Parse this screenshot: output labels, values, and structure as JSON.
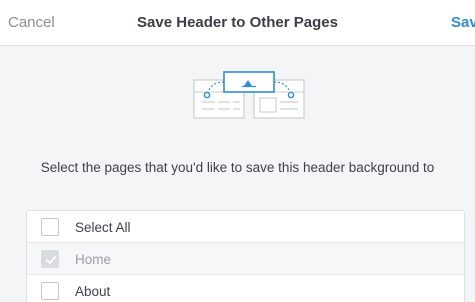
{
  "header": {
    "cancel_label": "Cancel",
    "title": "Save Header to Other Pages",
    "save_label": "Save"
  },
  "instruction": "Select the pages that you'd like to save this header background to",
  "pages": [
    {
      "label": "Select All",
      "checked": false,
      "disabled": false
    },
    {
      "label": "Home",
      "checked": true,
      "disabled": true
    },
    {
      "label": "About",
      "checked": false,
      "disabled": false
    }
  ],
  "colors": {
    "accent": "#2f8ed8",
    "muted": "#8a8f96"
  }
}
